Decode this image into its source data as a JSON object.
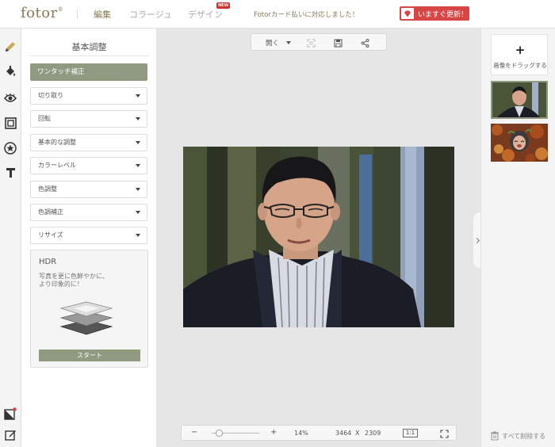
{
  "header": {
    "logo": "fotor",
    "logo_mark": "®",
    "nav": {
      "edit": "編集",
      "collage": "コラージュ",
      "design": "デザイン",
      "new_badge": "NEW"
    },
    "promo": "Fotorカード払いに対応しました！",
    "update_button": "いますぐ更新！"
  },
  "toolbar": {
    "tools": [
      "pencil-icon",
      "paint-bucket-icon",
      "eye-icon",
      "frame-icon",
      "sticker-star-icon",
      "text-icon"
    ],
    "bottom_tools": [
      "layer-icon",
      "edit-note-icon"
    ]
  },
  "panel": {
    "title": "基本調整",
    "one_touch": "ワンタッチ補正",
    "sections": [
      "切り取り",
      "回転",
      "基本的な調整",
      "カラーレベル",
      "色調整",
      "色調補正",
      "リサイズ"
    ],
    "hdr": {
      "title": "HDR",
      "desc_line1": "写真を更に色鮮やかに、",
      "desc_line2": "より印象的に！",
      "start": "スタート"
    }
  },
  "canvas": {
    "open_label": "開く",
    "zoom_minus": "−",
    "zoom_plus": "+",
    "zoom_level": "14%",
    "zoom_fraction": 0.15,
    "width": "3464",
    "x": "X",
    "height": "2309",
    "one_to_one": "1:1"
  },
  "right_panel": {
    "drop_plus": "+",
    "drop_text": "画像をドラッグする",
    "delete_all": "すべて削除する"
  },
  "colors": {
    "accent_green": "#8f9a80",
    "brand_gold": "#8a7a56",
    "update_red": "#d84545"
  }
}
